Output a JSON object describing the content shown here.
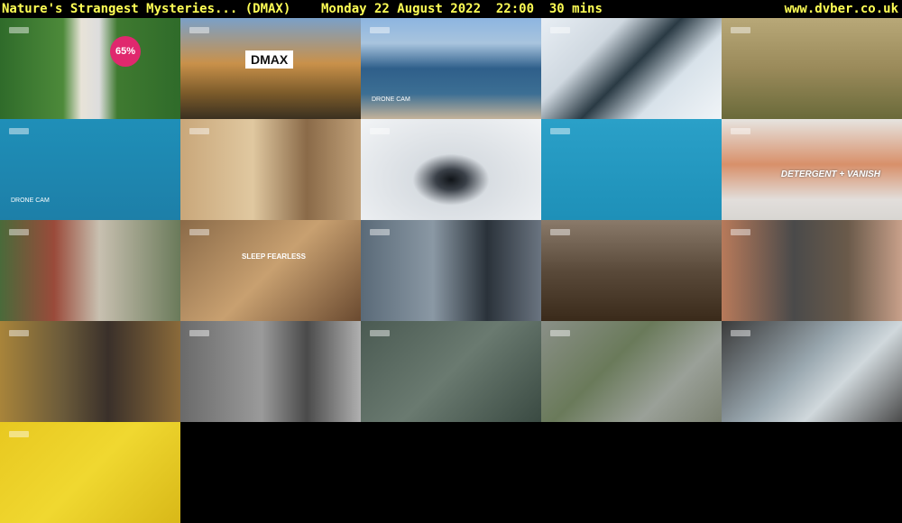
{
  "header": {
    "title": "Nature's Strangest Mysteries... (DMAX)    Monday 22 August 2022  22:00  30 mins",
    "site": "www.dvber.co.uk"
  },
  "thumbnails": [
    {
      "desc": "alpaca",
      "bg": "linear-gradient(90deg,#2f6b2a 0%,#4d8a3a 35%,#e8e3d8 45%,#ddd 55%,#3f7a30 65%,#2f6b2a 100%)",
      "caption": "65%"
    },
    {
      "desc": "forest-river",
      "bg": "linear-gradient(180deg,#7aa0c8 0%,#c9914a 45%,#7a5a2a 75%,#3a3020 100%)",
      "caption": "DMAX"
    },
    {
      "desc": "lake-aerial",
      "bg": "linear-gradient(180deg,#8db5e0 0%,#a8c4de 25%,#2f5f8a 50%,#3c6f94 75%,#c4b39a 100%)",
      "caption": "DRONE CAM"
    },
    {
      "desc": "ice-cracks",
      "bg": "linear-gradient(135deg,#e8eef4 0%,#cfd8e0 30%,#2a3a44 50%,#d8e2ea 70%,#f0f4f7 100%)",
      "caption": ""
    },
    {
      "desc": "grassland-animal",
      "bg": "linear-gradient(180deg,#b8a878 0%,#9a8a5a 50%,#6a6a3a 100%)",
      "caption": ""
    },
    {
      "desc": "water-drone",
      "bg": "linear-gradient(180deg,#1f8fb8 0%,#1d7fa8 100%)",
      "caption": "DRONE CAM"
    },
    {
      "desc": "presenter-room",
      "bg": "linear-gradient(90deg,#c9a77a 0%,#e0c8a0 40%,#8a6a48 70%,#c2a27a 100%)",
      "caption": ""
    },
    {
      "desc": "ice-hole",
      "bg": "radial-gradient(ellipse at 50% 60%,#101418 0%,#3a4048 12%,#d8dde2 30%,#f2f4f6 100%)",
      "caption": ""
    },
    {
      "desc": "blue-water",
      "bg": "linear-gradient(180deg,#2aa0c8 0%,#1e90b8 100%)",
      "caption": ""
    },
    {
      "desc": "detergent-vanish",
      "bg": "linear-gradient(180deg,#e6e4e0 0%,#d8906a 45%,#e2dedb 80%,#d8d6d2 100%)",
      "caption": "DETERGENT + VANISH"
    },
    {
      "desc": "couple-ad",
      "bg": "linear-gradient(90deg,#4a6a3a 0%,#9a4a3a 30%,#c8c0b0 55%,#6a7a5a 100%)",
      "caption": ""
    },
    {
      "desc": "sleep-fearless",
      "bg": "linear-gradient(135deg,#8a6a48 0%,#c8a070 50%,#6a4a30 100%)",
      "caption": "SLEEP FEARLESS"
    },
    {
      "desc": "man-glasses",
      "bg": "linear-gradient(90deg,#5a6a78 0%,#8a98a4 40%,#2a323a 70%,#6a7480 100%)",
      "caption": ""
    },
    {
      "desc": "beaver",
      "bg": "linear-gradient(180deg,#8a7a6a 0%,#5a4a3a 50%,#3a2a1a 100%)",
      "caption": ""
    },
    {
      "desc": "man-speaking",
      "bg": "linear-gradient(90deg,#b87a5a 0%,#4a4a4a 40%,#6a5a4a 70%,#c8a08a 100%)",
      "caption": ""
    },
    {
      "desc": "wolf-closeup",
      "bg": "linear-gradient(90deg,#a8843a 0%,#6a5a3a 35%,#3a302a 60%,#8a6a3a 100%)",
      "caption": ""
    },
    {
      "desc": "wolves-fighting",
      "bg": "linear-gradient(90deg,#6a6a6a 0%,#9a9a9a 45%,#4a4a4a 70%,#b0b0b0 100%)",
      "caption": ""
    },
    {
      "desc": "map-graphic",
      "bg": "linear-gradient(135deg,#4a5a52 0%,#6a7a70 50%,#3a4a42 100%)",
      "caption": ""
    },
    {
      "desc": "sinkhole-aerial",
      "bg": "linear-gradient(135deg,#8a9088 0%,#6a7a5a 40%,#9aa098 70%,#7a8070 100%)",
      "caption": ""
    },
    {
      "desc": "hail-machine",
      "bg": "linear-gradient(135deg,#3a3a3a 0%,#9aa8b0 45%,#d0d8dc 65%,#4a4a4a 100%)",
      "caption": ""
    },
    {
      "desc": "yellow-products",
      "bg": "linear-gradient(135deg,#e8c820 0%,#f0d830 50%,#d8b818 100%)",
      "caption": ""
    }
  ]
}
